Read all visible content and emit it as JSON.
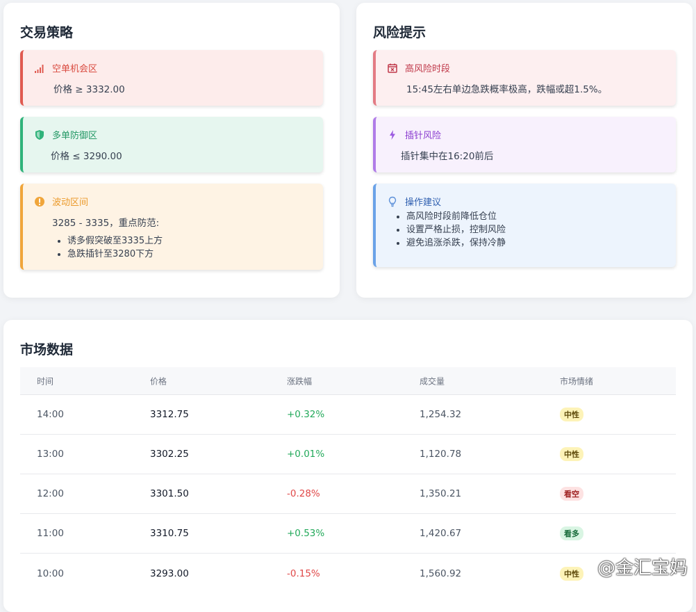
{
  "strategy": {
    "title": "交易策略",
    "short_zone": {
      "title": "空单机会区",
      "text": "价格 ≥ 3332.00",
      "icon": "signal-bars-icon"
    },
    "long_zone": {
      "title": "多单防御区",
      "text": "价格 ≤ 3290.00",
      "icon": "shield-icon"
    },
    "range_zone": {
      "title": "波动区间",
      "text": "3285 - 3335，重点防范:",
      "icon": "alert-circle-icon",
      "items": [
        "诱多假突破至3335上方",
        "急跌插针至3280下方"
      ]
    }
  },
  "risk": {
    "title": "风险提示",
    "high_risk": {
      "title": "高风险时段",
      "text": "15:45左右单边急跌概率极高，跌幅或超1.5%。",
      "icon": "calendar-x-icon"
    },
    "spike_risk": {
      "title": "插针风险",
      "text": "插针集中在16:20前后",
      "icon": "lightning-icon"
    },
    "advice": {
      "title": "操作建议",
      "icon": "lightbulb-icon",
      "items": [
        "高风险时段前降低仓位",
        "设置严格止损，控制风险",
        "避免追涨杀跌，保持冷静"
      ]
    }
  },
  "market": {
    "title": "市场数据",
    "headers": [
      "时间",
      "价格",
      "涨跌幅",
      "成交量",
      "市场情绪"
    ],
    "rows": [
      {
        "time": "14:00",
        "price": "3312.75",
        "change": "+0.32%",
        "volume": "1,254.32",
        "sentiment": "中性"
      },
      {
        "time": "13:00",
        "price": "3302.25",
        "change": "+0.01%",
        "volume": "1,120.78",
        "sentiment": "中性"
      },
      {
        "time": "12:00",
        "price": "3301.50",
        "change": "-0.28%",
        "volume": "1,350.21",
        "sentiment": "看空"
      },
      {
        "time": "11:00",
        "price": "3310.75",
        "change": "+0.53%",
        "volume": "1,420.67",
        "sentiment": "看多"
      },
      {
        "time": "10:00",
        "price": "3293.00",
        "change": "-0.15%",
        "volume": "1,560.92",
        "sentiment": "中性"
      }
    ]
  },
  "watermark": "@金汇宝妈",
  "colors": {
    "up": "#22a95a",
    "down": "#e04848",
    "short_accent": "#e05a50",
    "long_accent": "#2fb37a",
    "range_accent": "#f0a53a"
  }
}
